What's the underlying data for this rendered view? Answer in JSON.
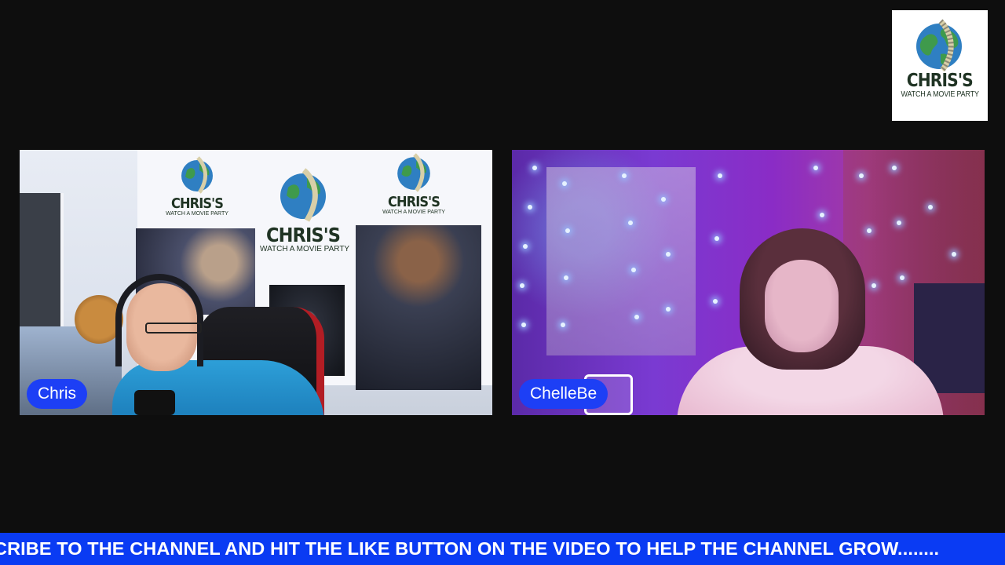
{
  "brand": {
    "title": "CHRIS'S",
    "subtitle": "WATCH A MOVIE PARTY"
  },
  "participants": [
    {
      "name": "Chris"
    },
    {
      "name": "ChelleBe"
    }
  ],
  "ticker": {
    "text": "CRIBE TO THE CHANNEL AND HIT THE LIKE BUTTON ON THE VIDEO TO HELP THE CHANNEL GROW........"
  },
  "colors": {
    "background": "#0e0e0e",
    "name_tag": "#1d3ff5",
    "ticker": "#0a3bf3",
    "logo_text": "#1f3323"
  }
}
